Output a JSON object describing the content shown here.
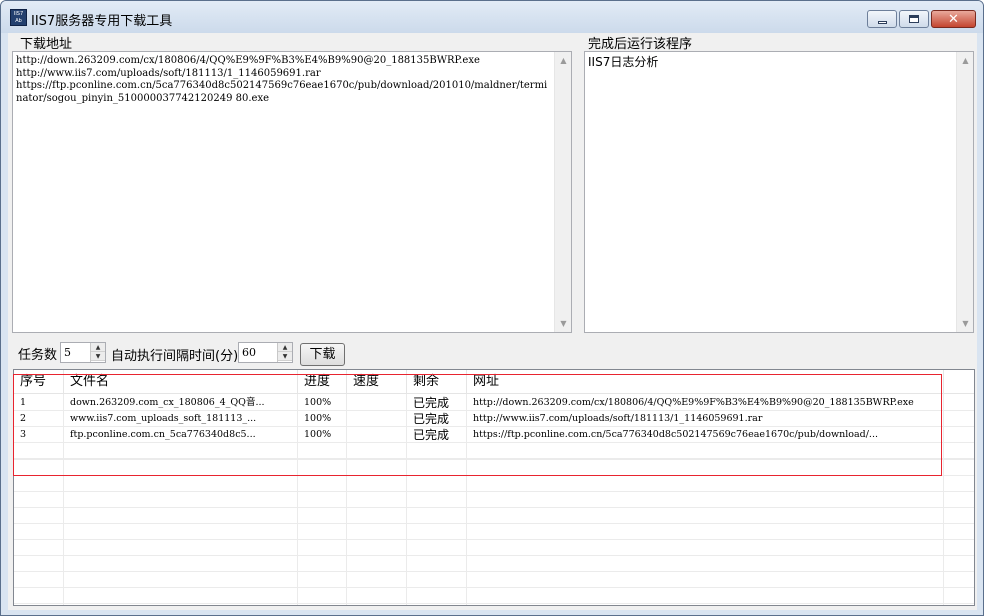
{
  "window": {
    "title": "IIS7服务器专用下载工具",
    "icon_text": "IIS7 Ab",
    "icon_name": "iis7-app-icon"
  },
  "download": {
    "label": "下载地址",
    "urls_text": "http://down.263209.com/cx/180806/4/QQ%E9%9F%B3%E4%B9%90@20_188135BWRP.exe\nhttp://www.iis7.com/uploads/soft/181113/1_1146059691.rar\nhttps://ftp.pconline.com.cn/5ca776340d8c502147569c76eae1670c/pub/download/201010/maldner/terminator/sogou_pinyin_510000037742120249 80.exe"
  },
  "after_complete": {
    "label": "完成后运行该程序",
    "program_text": "IIS7日志分析"
  },
  "controls": {
    "tasks_label": "任务数",
    "tasks_value": "5",
    "interval_label": "自动执行间隔时间(分)",
    "interval_value": "60",
    "download_button": "下载"
  },
  "table": {
    "columns": [
      "序号",
      "文件名",
      "进度",
      "速度",
      "剩余",
      "网址"
    ],
    "rows": [
      {
        "index": "1",
        "filename": "down.263209.com_cx_180806_4_QQ音...",
        "progress": "100%",
        "speed": "",
        "remaining": "已完成",
        "url": "http://down.263209.com/cx/180806/4/QQ%E9%9F%B3%E4%B9%90@20_188135BWRP.exe"
      },
      {
        "index": "2",
        "filename": "www.iis7.com_uploads_soft_181113_...",
        "progress": "100%",
        "speed": "",
        "remaining": "已完成",
        "url": "http://www.iis7.com/uploads/soft/181113/1_1146059691.rar"
      },
      {
        "index": "3",
        "filename": "ftp.pconline.com.cn_5ca776340d8c5...",
        "progress": "100%",
        "speed": "",
        "remaining": "已完成",
        "url": "https://ftp.pconline.com.cn/5ca776340d8c502147569c76eae1670c/pub/download/..."
      }
    ]
  },
  "colors": {
    "highlight_border": "#e8242f",
    "window_frame": "#d9e4f1"
  }
}
